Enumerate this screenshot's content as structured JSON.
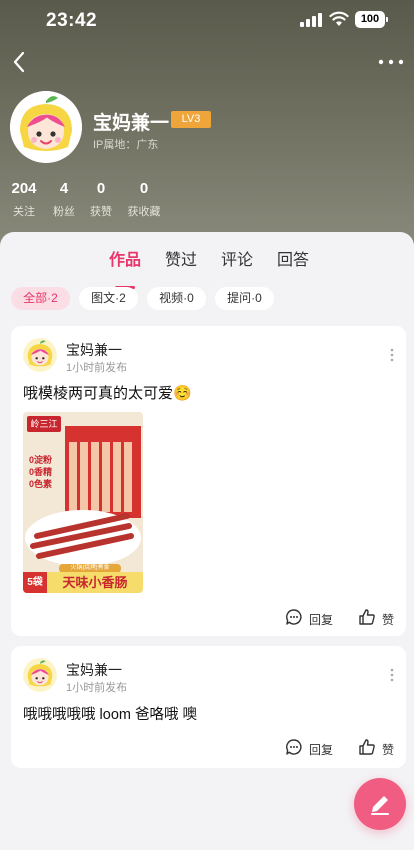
{
  "status_bar": {
    "time": "23:42",
    "battery": "100"
  },
  "profile": {
    "name": "宝妈兼一",
    "level": "LV3",
    "ip_location": "IP属地：广东",
    "stats": [
      {
        "value": "204",
        "label": "关注"
      },
      {
        "value": "4",
        "label": "粉丝"
      },
      {
        "value": "0",
        "label": "获赞"
      },
      {
        "value": "0",
        "label": "获收藏"
      }
    ]
  },
  "tabs": [
    {
      "label": "作品",
      "active": true
    },
    {
      "label": "赞过",
      "active": false
    },
    {
      "label": "评论",
      "active": false
    },
    {
      "label": "回答",
      "active": false
    }
  ],
  "filters": [
    {
      "label": "全部·2",
      "active": true
    },
    {
      "label": "图文·2",
      "active": false
    },
    {
      "label": "视频·0",
      "active": false
    },
    {
      "label": "提问·0",
      "active": false
    }
  ],
  "posts": [
    {
      "author": "宝妈兼一",
      "time": "1小时前发布",
      "text": "哦模棱两可真的太可爱☺️",
      "image": {
        "brand": "岭三江",
        "claims": [
          "0淀粉",
          "0香精",
          "0色素"
        ],
        "tag": "火锅|烧烤|煮食",
        "count": "5袋",
        "product": "天味小香肠"
      },
      "reply_label": "回复",
      "like_label": "赞"
    },
    {
      "author": "宝妈兼一",
      "time": "1小时前发布",
      "text": "哦哦哦哦哦 loom 爸咯哦 噢",
      "reply_label": "回复",
      "like_label": "赞"
    }
  ],
  "colors": {
    "accent": "#e8356a",
    "fab": "#f05c82",
    "level_badge": "#f0a53b"
  },
  "icons": [
    "back-icon",
    "more-icon",
    "reply-icon",
    "like-icon",
    "edit-icon",
    "menu-dots-icon"
  ]
}
